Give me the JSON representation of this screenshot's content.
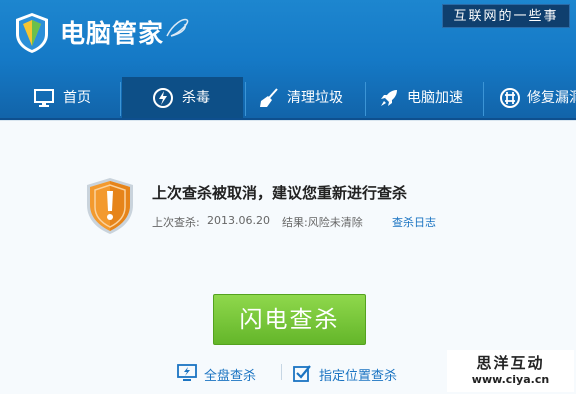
{
  "app": {
    "title": "电脑管家",
    "slogan": "互联网的一些事"
  },
  "nav": {
    "items": [
      {
        "label": "首页",
        "icon": "monitor-icon"
      },
      {
        "label": "杀毒",
        "icon": "lightning-icon",
        "active": true
      },
      {
        "label": "清理垃圾",
        "icon": "broom-icon"
      },
      {
        "label": "电脑加速",
        "icon": "rocket-icon"
      },
      {
        "label": "修复漏洞",
        "icon": "patch-icon"
      }
    ]
  },
  "main": {
    "status_title": "上次查杀被取消，建议您重新进行查杀",
    "last_scan_label": "上次查杀:",
    "last_scan_date": "2013.06.20",
    "result": "结果:风险未清除",
    "log_link": "查杀日志",
    "scan_button": "闪电查杀",
    "full_scan": "全盘查杀",
    "custom_scan": "指定位置查杀"
  },
  "watermark": {
    "title": "思洋互动",
    "url": "www.ciya.cn"
  },
  "colors": {
    "header": "#1579c6",
    "active_tab": "#0d4f87",
    "accent_green": "#7bc83a",
    "link": "#1b74c2",
    "shield_orange": "#f39a2e"
  }
}
